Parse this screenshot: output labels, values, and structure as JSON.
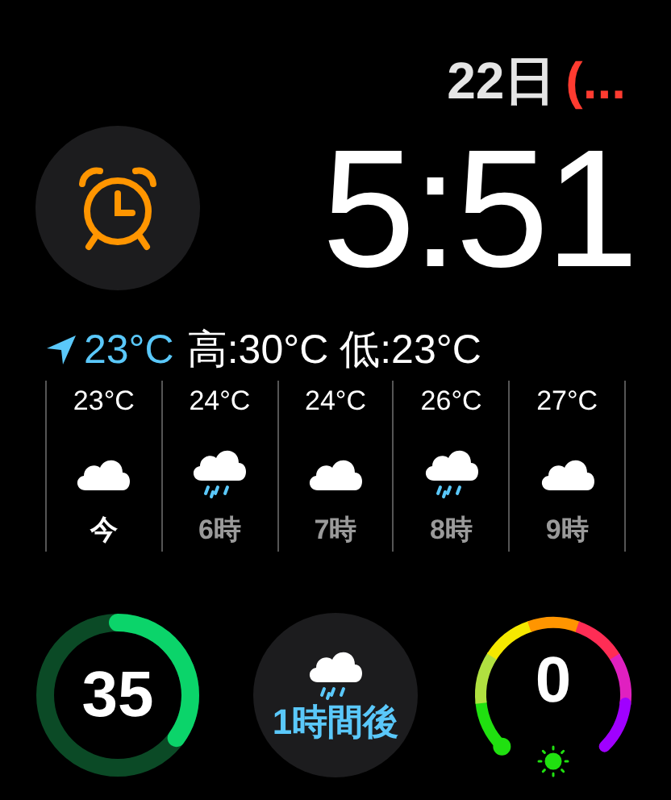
{
  "date": {
    "day": "22日",
    "event": "(..."
  },
  "time": "5:51",
  "weather": {
    "current": "23°C",
    "range": "高:30°C 低:23°C",
    "hours": [
      {
        "temp": "23°C",
        "kind": "cloud",
        "label": "今",
        "selected": true
      },
      {
        "temp": "24°C",
        "kind": "rain",
        "label": "6時",
        "selected": false
      },
      {
        "temp": "24°C",
        "kind": "cloud",
        "label": "7時",
        "selected": false
      },
      {
        "temp": "26°C",
        "kind": "rain",
        "label": "8時",
        "selected": false
      },
      {
        "temp": "27°C",
        "kind": "cloud",
        "label": "9時",
        "selected": false
      }
    ]
  },
  "activity": {
    "value": "35"
  },
  "rain_forecast": {
    "label": "1時間後"
  },
  "uv": {
    "value": "0"
  }
}
